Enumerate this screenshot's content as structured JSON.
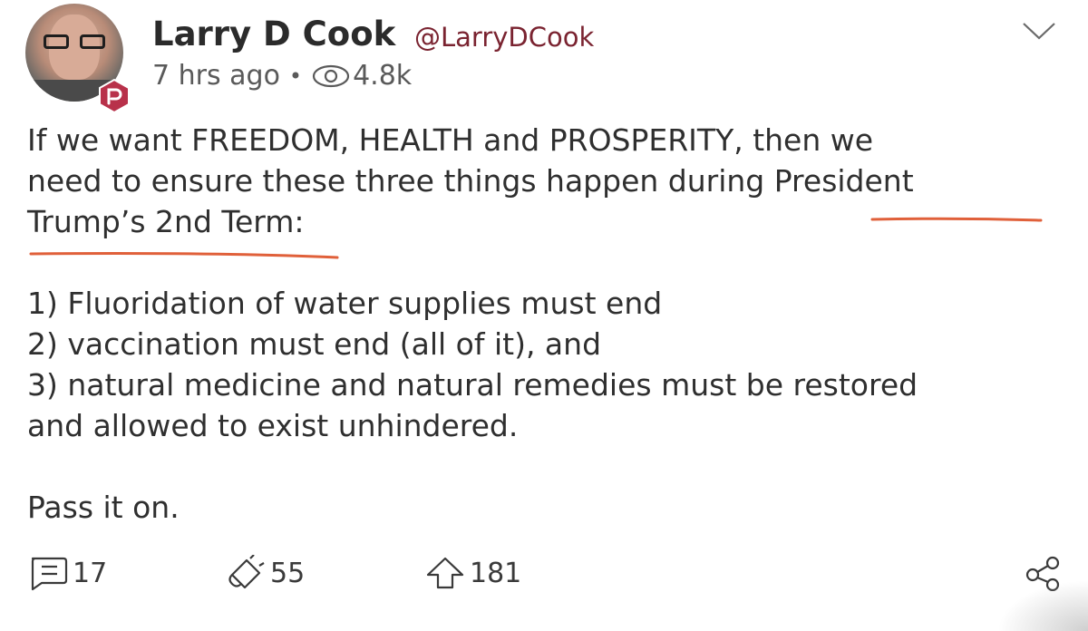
{
  "author": {
    "display_name": "Larry D Cook",
    "handle": "@LarryDCook",
    "avatar_icon": "avatar-photo",
    "badge_icon": "parler-badge-icon",
    "badge_color": "#b8314a"
  },
  "meta": {
    "time": "7 hrs ago",
    "separator": "•",
    "view_icon": "eye-icon",
    "views": "4.8k"
  },
  "menu_icon": "chevron-down-icon",
  "post": {
    "lines": [
      "If we want FREEDOM, HEALTH and PROSPERITY, then we",
      "need to ensure these three things happen during President",
      "Trump’s 2nd Term:"
    ],
    "list": [
      "1) Fluoridation of water supplies must end",
      "2) vaccination must end (all of it), and",
      "3) natural medicine and natural remedies must be restored",
      "and allowed to exist unhindered."
    ],
    "closing": "Pass it on.",
    "underline_color": "#e0603a"
  },
  "actions": {
    "comments": {
      "icon": "comment-icon",
      "count": "17"
    },
    "echoes": {
      "icon": "megaphone-icon",
      "count": "55"
    },
    "upvotes": {
      "icon": "upvote-arrow-icon",
      "count": "181"
    },
    "share": {
      "icon": "share-icon"
    }
  }
}
